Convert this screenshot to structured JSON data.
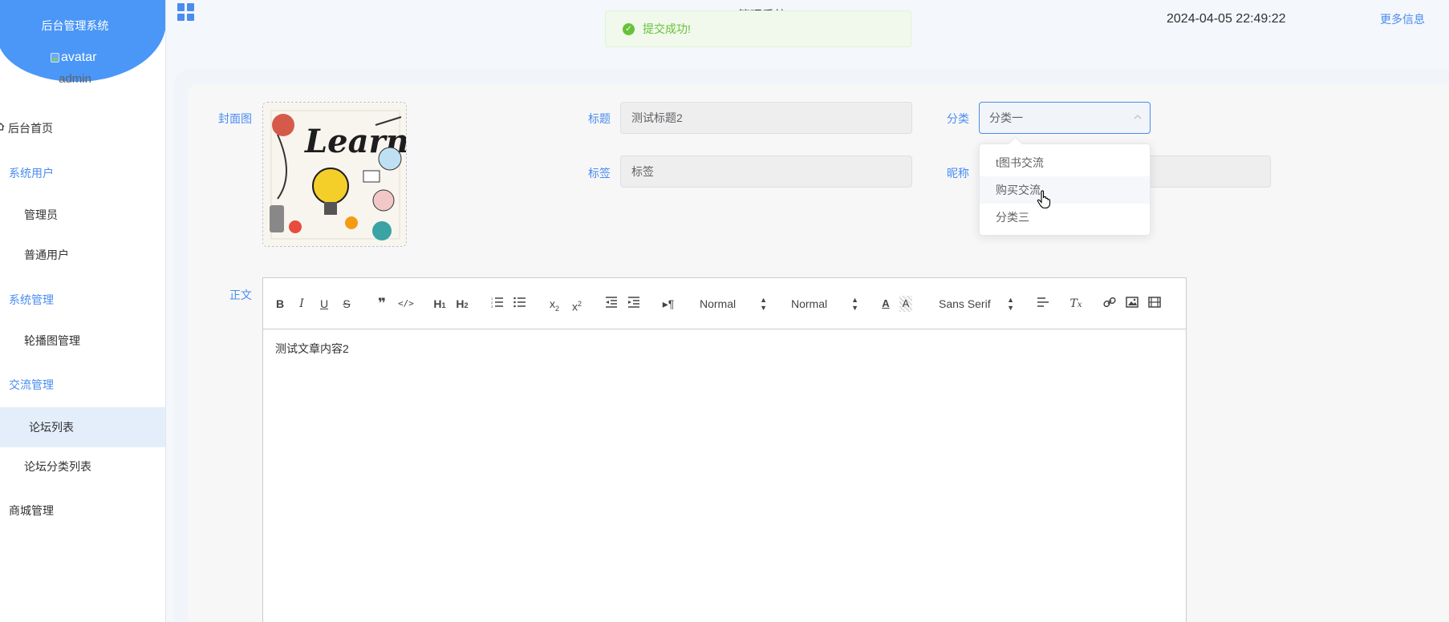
{
  "sidebar": {
    "title": "后台管理系统",
    "avatar_alt": "avatar",
    "username": "admin",
    "items": [
      {
        "label": "后台首页"
      },
      {
        "label": "系统用户"
      },
      {
        "label": "管理员"
      },
      {
        "label": "普通用户"
      },
      {
        "label": "系统管理"
      },
      {
        "label": "轮播图管理"
      },
      {
        "label": "交流管理"
      },
      {
        "label": "论坛列表"
      },
      {
        "label": "论坛分类列表"
      },
      {
        "label": "商城管理"
      }
    ],
    "active_item": "论坛列表",
    "accent_color": "#4a97f8"
  },
  "header": {
    "title": "管理系统",
    "datetime": "2024-04-05 22:49:22",
    "more_label": "更多信息"
  },
  "toast": {
    "message": "提交成功!",
    "type": "success"
  },
  "form": {
    "cover_label": "封面图",
    "title_label": "标题",
    "title_value": "测试标题2",
    "category_label": "分类",
    "category_value": "分类一",
    "tags_label": "标签",
    "tags_value": "标签",
    "nickname_label": "昵称",
    "body_label": "正文",
    "category_options": [
      "t图书交流",
      "购买交流",
      "分类三"
    ],
    "hovered_option": "购买交流"
  },
  "editor": {
    "header_select": "Normal",
    "size_select": "Normal",
    "font_select": "Sans Serif",
    "content": "测试文章内容2"
  }
}
